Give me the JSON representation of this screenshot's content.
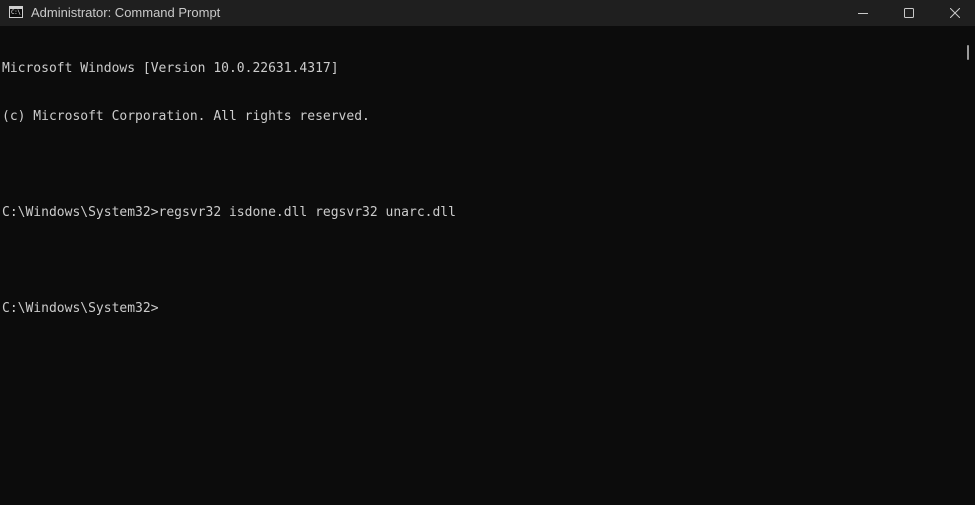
{
  "window": {
    "title": "Administrator: Command Prompt",
    "icon": "cmd-icon",
    "icon_text": "C:\\"
  },
  "controls": {
    "minimize_icon": "minimize-icon",
    "maximize_icon": "maximize-icon",
    "close_icon": "close-icon"
  },
  "console": {
    "lines": [
      "Microsoft Windows [Version 10.0.22631.4317]",
      "(c) Microsoft Corporation. All rights reserved.",
      "",
      "C:\\Windows\\System32>regsvr32 isdone.dll regsvr32 unarc.dll",
      "",
      "C:\\Windows\\System32>"
    ]
  },
  "colors": {
    "background": "#0c0c0c",
    "titlebar": "#1f1f1f",
    "text": "#cccccc"
  }
}
